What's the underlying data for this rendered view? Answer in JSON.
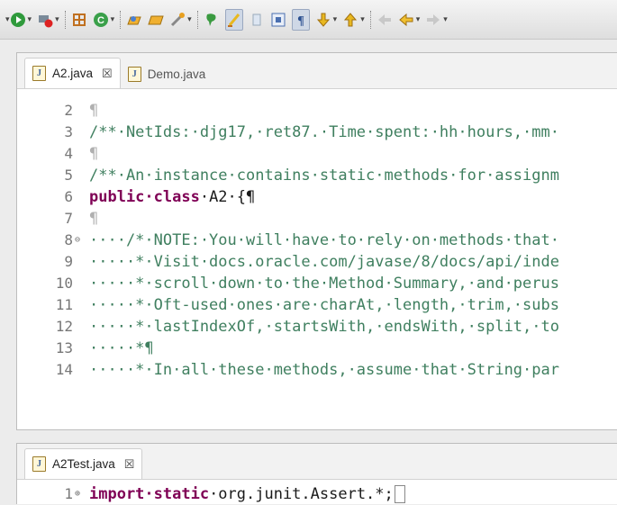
{
  "toolbar": {
    "icons": [
      "run-debug-icon",
      "run-icon",
      "external-tools-icon",
      "new-java-class-icon",
      "coverage-icon",
      "open-type-icon",
      "open-task-icon",
      "search-icon",
      "annotation-icon",
      "highlight-icon",
      "toggle-block-icon",
      "show-whitespace-icon",
      "next-annotation-icon",
      "previous-annotation-icon",
      "back-icon",
      "forward-icon"
    ]
  },
  "editor_top": {
    "tabs": [
      {
        "label": "A2.java",
        "close": "☒"
      },
      {
        "label": "Demo.java"
      }
    ],
    "lines": [
      {
        "num": "2",
        "text": "¶"
      },
      {
        "num": "3",
        "text": "/**·NetIds:·djg17,·ret87.·Time·spent:·hh·hours,·mm·"
      },
      {
        "num": "4",
        "text": "¶"
      },
      {
        "num": "5",
        "text": "/**·An·instance·contains·static·methods·for·assignm"
      },
      {
        "num": "6",
        "kw": "public·class",
        "rest": "·A2·{¶"
      },
      {
        "num": "7",
        "text": "¶"
      },
      {
        "num": "8",
        "text": "····/*·NOTE:·You·will·have·to·rely·on·methods·that·"
      },
      {
        "num": "9",
        "text": "·····*·Visit·docs.oracle.com/javase/8/docs/api/inde"
      },
      {
        "num": "10",
        "text": "·····*·scroll·down·to·the·Method·Summary,·and·perus"
      },
      {
        "num": "11",
        "text": "·····*·Oft-used·ones·are·charAt,·length,·trim,·subs"
      },
      {
        "num": "12",
        "text": "·····*·lastIndexOf,·startsWith,·endsWith,·split,·to"
      },
      {
        "num": "13",
        "text": "·····*¶"
      },
      {
        "num": "14",
        "text": "·····*·In·all·these·methods,·assume·that·String·par"
      }
    ]
  },
  "editor_bottom": {
    "tabs": [
      {
        "label": "A2Test.java",
        "close": "☒"
      }
    ],
    "line": {
      "num": "1",
      "kw": "import·static",
      "rest": "·org.junit.Assert.*;"
    }
  }
}
